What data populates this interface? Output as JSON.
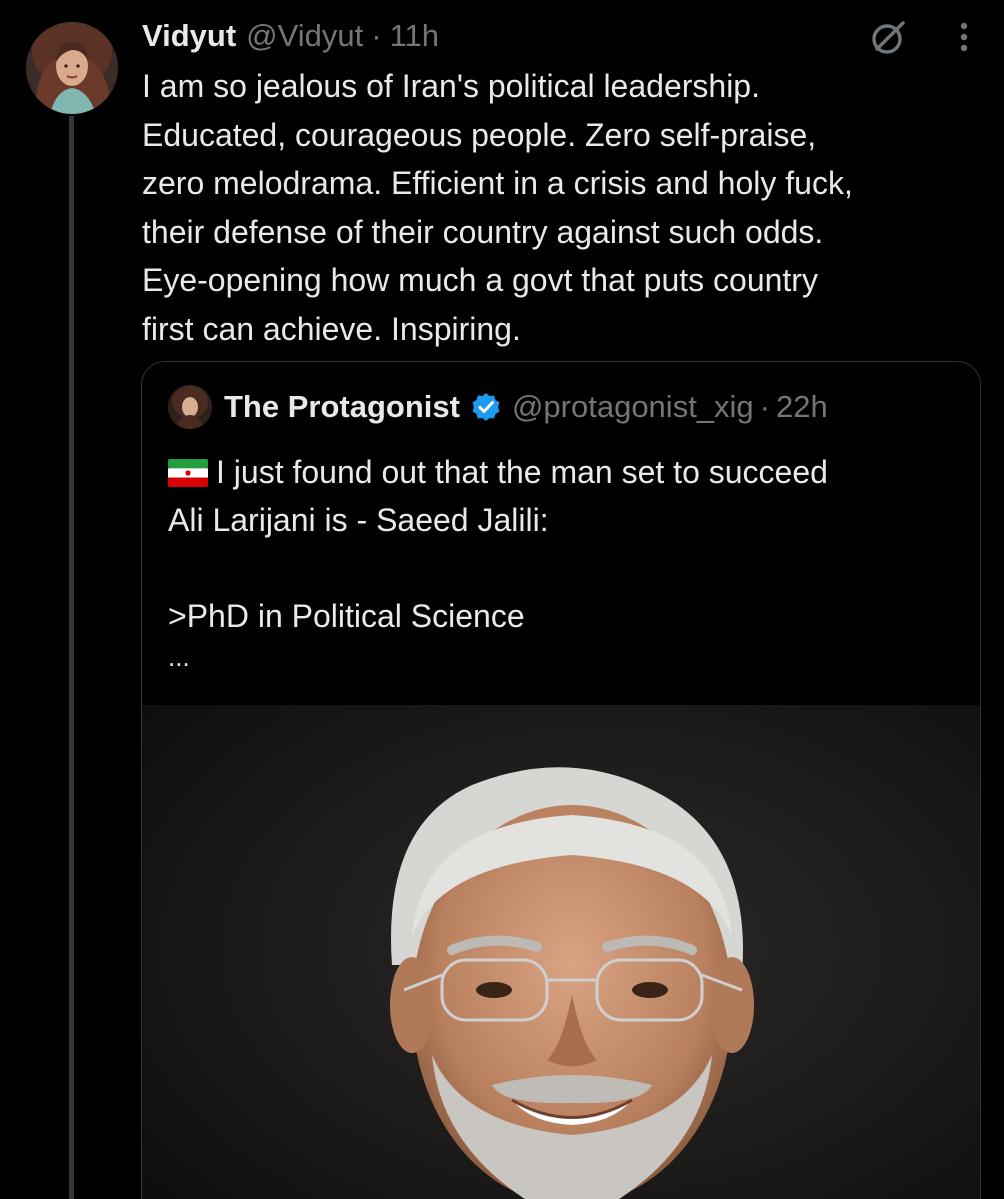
{
  "tweet": {
    "author_name": "Vidyut",
    "author_handle": "@Vidyut",
    "separator": "·",
    "time": "11h",
    "text": "I am so jealous of Iran's political leadership.\nEducated, courageous people. Zero self-praise,\nzero melodrama. Efficient in a crisis and holy fuck,\ntheir defense of their country against such odds.\nEye-opening how much a govt that puts country\nfirst can achieve. Inspiring.",
    "icons": {
      "grok": "grok-icon",
      "more": "more-options-icon",
      "avatar": "avatar"
    }
  },
  "quote": {
    "author_name": "The Protagonist",
    "author_handle": "@protagonist_xig",
    "separator": "·",
    "time": "22h",
    "lines": [
      "I just found out that the man set to succeed",
      "Ali Larijani is - Saeed Jalili:",
      "",
      ">PhD in Political Science"
    ],
    "ellipsis": "...",
    "icons": {
      "verified": "verified-badge-icon",
      "flag": "iran-flag-icon"
    },
    "media": "photo"
  },
  "colors": {
    "background": "#000000",
    "text_primary": "#e7e9ea",
    "text_secondary": "#71767b",
    "border": "#2f3336",
    "verified_blue": "#1d9bf0"
  }
}
